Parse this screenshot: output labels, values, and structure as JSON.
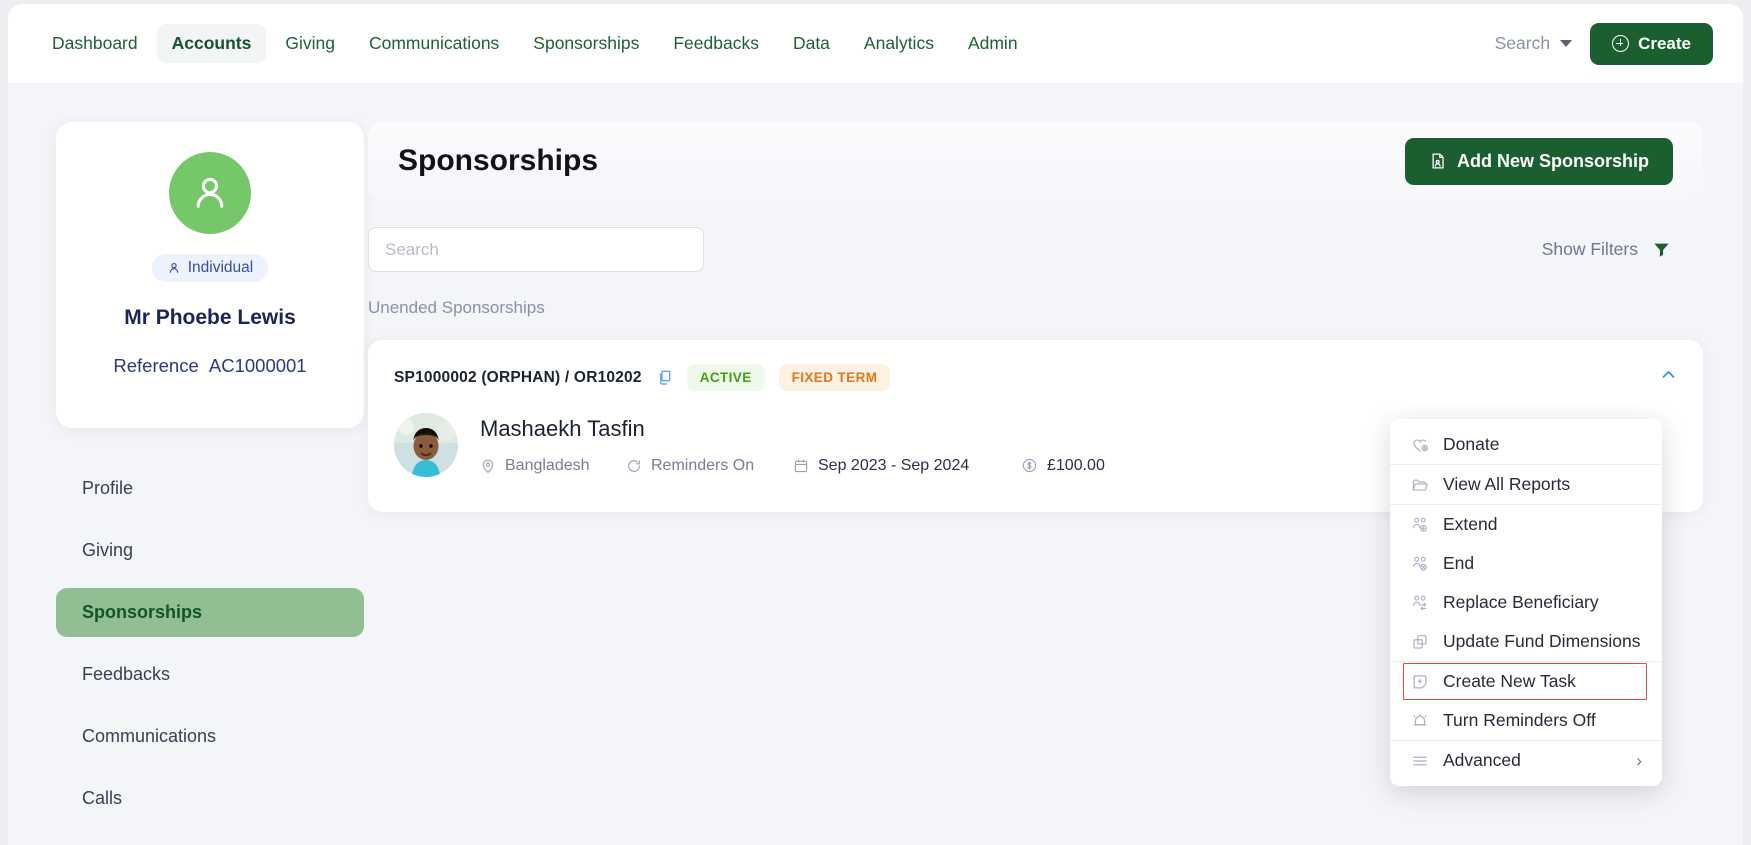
{
  "topnav": {
    "items": [
      {
        "label": "Dashboard",
        "active": false
      },
      {
        "label": "Accounts",
        "active": true
      },
      {
        "label": "Giving",
        "active": false
      },
      {
        "label": "Communications",
        "active": false
      },
      {
        "label": "Sponsorships",
        "active": false
      },
      {
        "label": "Feedbacks",
        "active": false
      },
      {
        "label": "Data",
        "active": false
      },
      {
        "label": "Analytics",
        "active": false
      },
      {
        "label": "Admin",
        "active": false
      }
    ],
    "search_label": "Search",
    "create_label": "Create"
  },
  "sidebar": {
    "account_type": "Individual",
    "account_name": "Mr Phoebe Lewis",
    "reference_label": "Reference",
    "reference_value": "AC1000001",
    "items": [
      {
        "label": "Profile",
        "active": false
      },
      {
        "label": "Giving",
        "active": false
      },
      {
        "label": "Sponsorships",
        "active": true
      },
      {
        "label": "Feedbacks",
        "active": false
      },
      {
        "label": "Communications",
        "active": false
      },
      {
        "label": "Calls",
        "active": false
      }
    ]
  },
  "main": {
    "page_title": "Sponsorships",
    "add_button_label": "Add New Sponsorship",
    "search_placeholder": "Search",
    "search_value": "",
    "show_filters_label": "Show Filters",
    "section_label": "Unended Sponsorships",
    "card": {
      "code": "SP1000002 (ORPHAN) / OR10202",
      "badge_active": "ACTIVE",
      "badge_fixed": "FIXED TERM",
      "beneficiary_name": "Mashaekh Tasfin",
      "country": "Bangladesh",
      "reminders": "Reminders On",
      "date_range": "Sep 2023 - Sep 2024",
      "amount": "£100.00"
    }
  },
  "menu": {
    "groups": [
      [
        {
          "label": "Donate",
          "icon": "heart-plus-icon",
          "highlight": false
        }
      ],
      [
        {
          "label": "View All Reports",
          "icon": "folder-icon",
          "highlight": false
        }
      ],
      [
        {
          "label": "Extend",
          "icon": "users-plus-icon",
          "highlight": false
        },
        {
          "label": "End",
          "icon": "users-x-icon",
          "highlight": false
        },
        {
          "label": "Replace Beneficiary",
          "icon": "users-swap-icon",
          "highlight": false
        },
        {
          "label": "Update Fund Dimensions",
          "icon": "copy-icon",
          "highlight": false
        }
      ],
      [
        {
          "label": "Create New Task",
          "icon": "note-plus-icon",
          "highlight": true
        },
        {
          "label": "Turn Reminders Off",
          "icon": "bell-off-icon",
          "highlight": false
        }
      ],
      [
        {
          "label": "Advanced",
          "icon": "menu-lines-icon",
          "highlight": false,
          "arrow": "›"
        }
      ]
    ]
  },
  "colors": {
    "brand_green": "#1b5e30",
    "nav_green": "#1e6034",
    "active_side": "#91bf93",
    "avatar_green": "#76c76a",
    "badge_active_text": "#3fa114",
    "badge_fixed_text": "#e2761b",
    "highlight_red": "#ef4444",
    "chevron_blue": "#2d8cf0"
  }
}
